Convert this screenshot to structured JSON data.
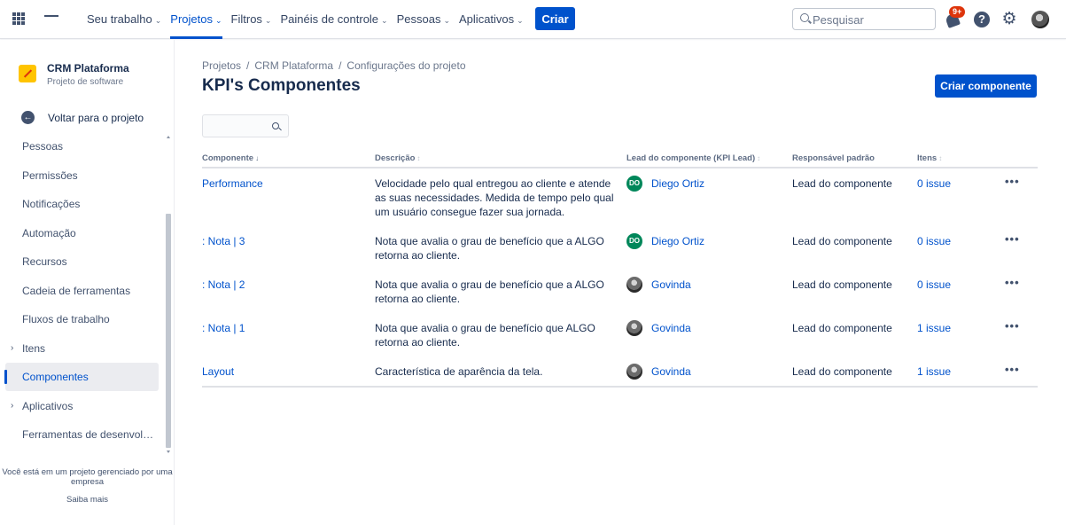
{
  "topnav": {
    "items": [
      {
        "label": "Seu trabalho"
      },
      {
        "label": "Projetos"
      },
      {
        "label": "Filtros"
      },
      {
        "label": "Painéis de controle"
      },
      {
        "label": "Pessoas"
      },
      {
        "label": "Aplicativos"
      }
    ],
    "active_item": "Projetos",
    "create_label": "Criar",
    "search_placeholder": "Pesquisar",
    "notifications_badge": "9+"
  },
  "sidebar": {
    "project_name": "CRM Plataforma",
    "project_type": "Projeto de software",
    "back_label": "Voltar para o projeto",
    "items": [
      {
        "label": "Pessoas",
        "expandable": false
      },
      {
        "label": "Permissões",
        "expandable": false
      },
      {
        "label": "Notificações",
        "expandable": false
      },
      {
        "label": "Automação",
        "expandable": false
      },
      {
        "label": "Recursos",
        "expandable": false
      },
      {
        "label": "Cadeia de ferramentas",
        "expandable": false
      },
      {
        "label": "Fluxos de trabalho",
        "expandable": false
      },
      {
        "label": "Itens",
        "expandable": true
      },
      {
        "label": "Componentes",
        "expandable": false,
        "active": true
      },
      {
        "label": "Aplicativos",
        "expandable": true
      },
      {
        "label": "Ferramentas de desenvol…",
        "expandable": false
      }
    ],
    "footer_note": "Você está em um projeto gerenciado por uma empresa",
    "learn_more": "Saiba mais"
  },
  "main": {
    "breadcrumb": [
      "Projetos",
      "CRM Plataforma",
      "Configurações do projeto"
    ],
    "title": "KPI's Componentes",
    "create_button": "Criar componente",
    "filter_value": "",
    "columns": {
      "component": "Componente",
      "description": "Descrição",
      "lead": "Lead do componente (KPI Lead)",
      "assignee": "Responsável padrão",
      "items": "Itens"
    },
    "rows": [
      {
        "name": "Performance",
        "description": "Velocidade pelo qual entregou ao cliente e atende as suas necessidades. Medida de tempo pelo qual um usuário consegue fazer sua jornada.",
        "lead": "Diego Ortiz",
        "lead_initials": "DO",
        "assignee": "Lead do componente",
        "items": "0 issue"
      },
      {
        "name": ": Nota | 3",
        "description": "Nota que avalia o grau de benefício que a ALGO retorna ao cliente.",
        "lead": "Diego Ortiz",
        "lead_initials": "DO",
        "assignee": "Lead do componente",
        "items": "0 issue"
      },
      {
        "name": ": Nota | 2",
        "description": "Nota que avalia o grau de benefício que a ALGO retorna ao cliente.",
        "lead": "Govinda",
        "lead_initials": "",
        "assignee": "Lead do componente",
        "items": "0 issue"
      },
      {
        "name": ": Nota | 1",
        "description": "Nota que avalia o grau de benefício que ALGO retorna ao cliente.",
        "lead": "Govinda",
        "lead_initials": "",
        "assignee": "Lead do componente",
        "items": "1 issue"
      },
      {
        "name": "Layout",
        "description": "Característica de aparência da tela.",
        "lead": "Govinda",
        "lead_initials": "",
        "assignee": "Lead do componente",
        "items": "1 issue"
      }
    ],
    "more_label": "•••"
  },
  "colors": {
    "primary": "#0052cc",
    "lead_avatar_green": "#00875a",
    "badge_red": "#de350b"
  }
}
